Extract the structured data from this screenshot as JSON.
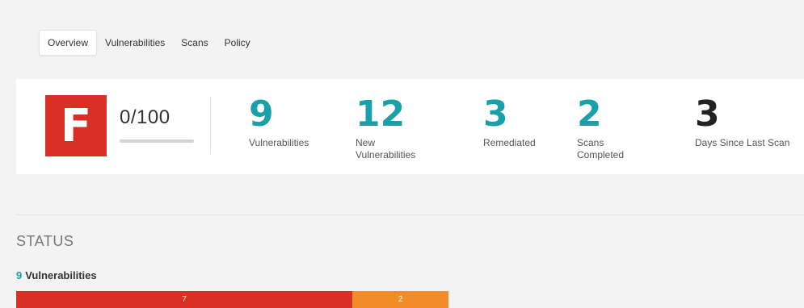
{
  "tabs": [
    {
      "label": "Overview",
      "active": true
    },
    {
      "label": "Vulnerabilities",
      "active": false
    },
    {
      "label": "Scans",
      "active": false
    },
    {
      "label": "Policy",
      "active": false
    }
  ],
  "grade": {
    "letter": "F",
    "score_text": "0/100",
    "score_value": 0,
    "score_max": 100,
    "color": "#d93025"
  },
  "metrics": [
    {
      "value": "9",
      "label": "Vulnerabilities",
      "color": "#19a0a8"
    },
    {
      "value": "12",
      "label": "New Vulnerabilities",
      "color": "#19a0a8"
    },
    {
      "value": "3",
      "label": "Remediated",
      "color": "#19a0a8"
    },
    {
      "value": "2",
      "label": "Scans Completed",
      "color": "#19a0a8"
    },
    {
      "value": "3",
      "label": "Days Since Last Scan",
      "color": "#222222"
    }
  ],
  "status": {
    "title": "STATUS",
    "vuln_count": "9",
    "vuln_label": "Vulnerabilities",
    "severity": [
      {
        "count": 7,
        "label": "7",
        "color": "#d93025"
      },
      {
        "count": 2,
        "label": "2",
        "color": "#f28c28"
      }
    ]
  }
}
